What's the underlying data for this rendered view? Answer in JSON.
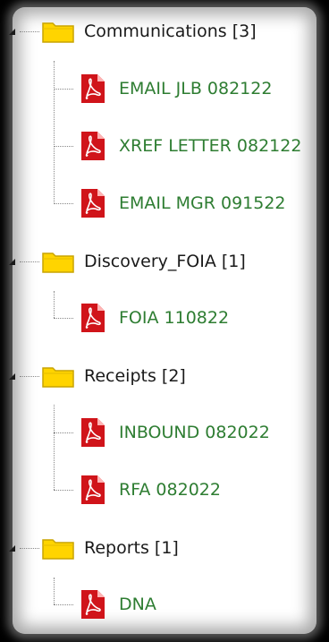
{
  "tree": {
    "folders": [
      {
        "label": "Communications [3]",
        "icon": "folder-icon",
        "files": [
          {
            "label": "EMAIL JLB 082122",
            "icon": "pdf-icon"
          },
          {
            "label": "XREF LETTER 082122",
            "icon": "pdf-icon"
          },
          {
            "label": "EMAIL MGR 091522",
            "icon": "pdf-icon"
          }
        ]
      },
      {
        "label": "Discovery_FOIA [1]",
        "icon": "folder-icon",
        "files": [
          {
            "label": "FOIA 110822",
            "icon": "pdf-icon"
          }
        ]
      },
      {
        "label": "Receipts [2]",
        "icon": "folder-icon",
        "files": [
          {
            "label": "INBOUND 082022",
            "icon": "pdf-icon"
          },
          {
            "label": "RFA 082022",
            "icon": "pdf-icon"
          }
        ]
      },
      {
        "label": "Reports [1]",
        "icon": "folder-icon",
        "files": [
          {
            "label": "DNA",
            "icon": "pdf-icon"
          }
        ]
      }
    ],
    "colors": {
      "file_text": "#2e7d32",
      "folder_fill": "#ffd400",
      "folder_stroke": "#c9a400",
      "pdf_red": "#d0141a"
    }
  }
}
